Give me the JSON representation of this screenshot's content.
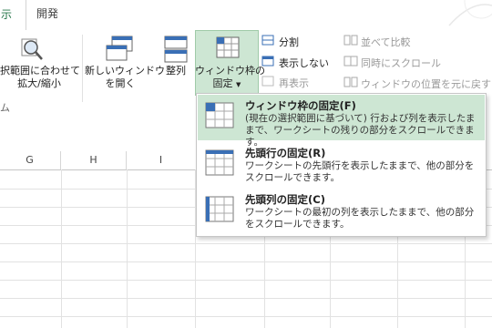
{
  "tabs": {
    "view": "示",
    "dev": "開発"
  },
  "ribbon": {
    "zoom_selection": [
      "択範囲に合わせて",
      "拡大/縮小"
    ],
    "new_window": [
      "新しいウィンドウ",
      "を開く"
    ],
    "arrange_all": "整列",
    "freeze_panes": [
      "ウィンドウ枠の",
      "固定"
    ],
    "split": "分割",
    "hide": "表示しない",
    "unhide": "再表示",
    "view_side_by_side": "並べて比較",
    "sync_scroll": "同時にスクロール",
    "reset_position": "ウィンドウの位置を元に戻す",
    "group_fragment": "ム"
  },
  "columns": [
    "G",
    "H",
    "I"
  ],
  "menu": [
    {
      "title": "ウィンドウ枠の固定(F)",
      "desc": "(現在の選択範囲に基づいて) 行および列を表示したままで、ワークシートの残りの部分をスクロールできます。",
      "highlighted": true
    },
    {
      "title": "先頭行の固定(R)",
      "desc": "ワークシートの先頭行を表示したままで、他の部分をスクロールできます。",
      "highlighted": false
    },
    {
      "title": "先頭列の固定(C)",
      "desc": "ワークシートの最初の列を表示したままで、他の部分をスクロールできます。",
      "highlighted": false
    }
  ],
  "colors": {
    "accent": "#217346",
    "highlight": "#cde6d3"
  }
}
